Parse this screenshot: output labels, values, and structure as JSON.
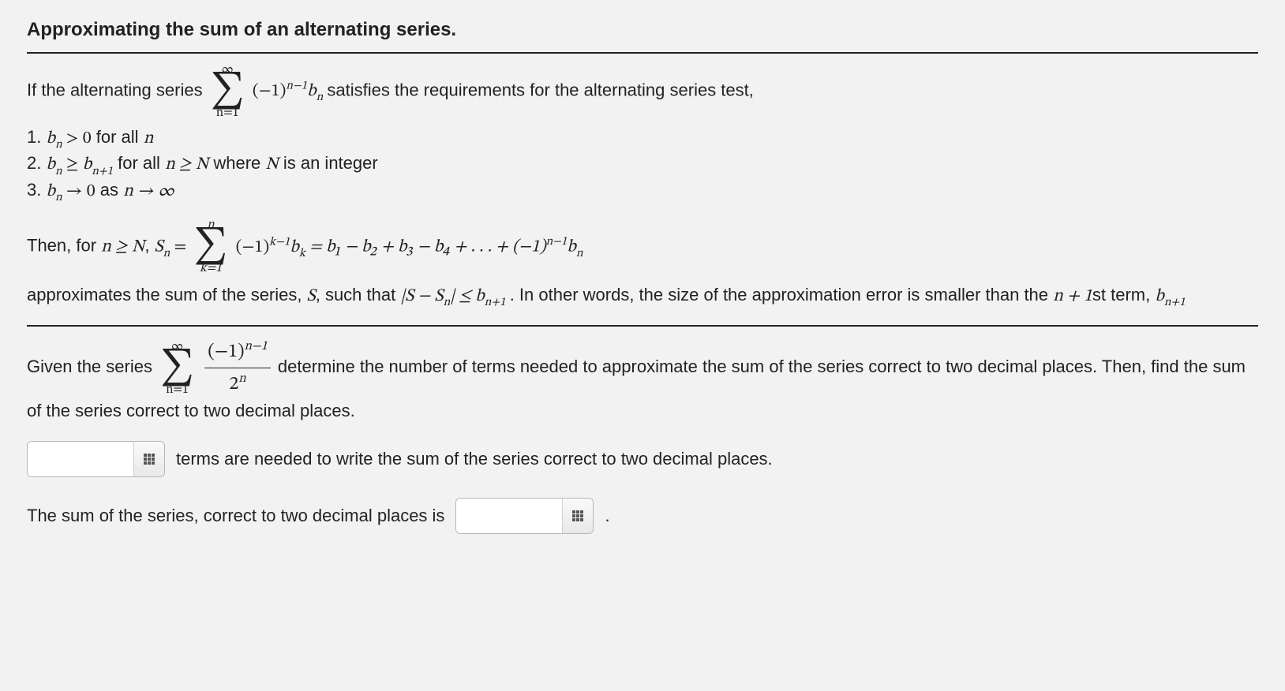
{
  "title": "Approximating the sum of an alternating series.",
  "intro_a": "If the alternating series ",
  "intro_b": " satisfies the requirements for the alternating series test,",
  "sum1": {
    "top": "∞",
    "bot": "n=1",
    "body_a": "(−1)",
    "body_exp": "n−1",
    "body_b": "b",
    "body_sub": "n"
  },
  "conds": {
    "c1_a": "1. ",
    "c1_math": "b",
    "c1_sub": "n",
    "c1_rel": " > 0",
    "c1_b": " for all ",
    "c1_n": "n",
    "c2_a": "2. ",
    "c2_l": "b",
    "c2_lsub": "n",
    "c2_rel": " ≥ ",
    "c2_r": "b",
    "c2_rsub": "n+1",
    "c2_b": " for all ",
    "c2_n": "n ≥ N",
    "c2_c": " where ",
    "c2_d": "N",
    "c2_e": " is an integer",
    "c3_a": "3. ",
    "c3_l": "b",
    "c3_lsub": "n",
    "c3_arr": " → 0",
    "c3_b": " as ",
    "c3_n": "n → ∞"
  },
  "then_a": "Then, for ",
  "then_cond": "n ≥ N",
  "then_b": ", ",
  "sn_l": "S",
  "sn_lsub": "n",
  "sn_eq": " = ",
  "sum2": {
    "top": "n",
    "bot": "k=1"
  },
  "sum2_body_a": "(−1)",
  "sum2_body_exp": "k−1",
  "sum2_body_b": "b",
  "sum2_body_sub": "k",
  "expand": " = b₁ − b₂ + b₃ − b₄ + . . . + (−1)",
  "expand_exp": "n−1",
  "expand_b": "b",
  "expand_sub": "n",
  "para2_a": "approximates the sum of the series, ",
  "para2_S": "S",
  "para2_b": ", such that ",
  "para2_ineq_a": "|S − S",
  "para2_ineq_sub": "n",
  "para2_ineq_b": "| ≤ b",
  "para2_ineq_sub2": "n+1",
  "para2_c": ". In other words, the size of the approximation error is smaller than the ",
  "para2_d": "n + 1",
  "para2_e": "st term, ",
  "para2_f": "b",
  "para2_fsub": "n+1",
  "given_a": "Given the series ",
  "sum3": {
    "top": "∞",
    "bot": "n=1"
  },
  "frac": {
    "num_a": "(−1)",
    "num_exp": "n−1",
    "den_a": "2",
    "den_exp": "n"
  },
  "given_b": " determine the number of terms needed to approximate the sum of the series correct to two decimal places. Then, find the sum of the series correct to two decimal places.",
  "ans1_text": "terms are needed to write the sum of the series correct to two decimal places.",
  "ans2_text": "The sum of the series, correct to two decimal places is",
  "period": ".",
  "answers": {
    "n_terms": "",
    "sum_value": ""
  }
}
